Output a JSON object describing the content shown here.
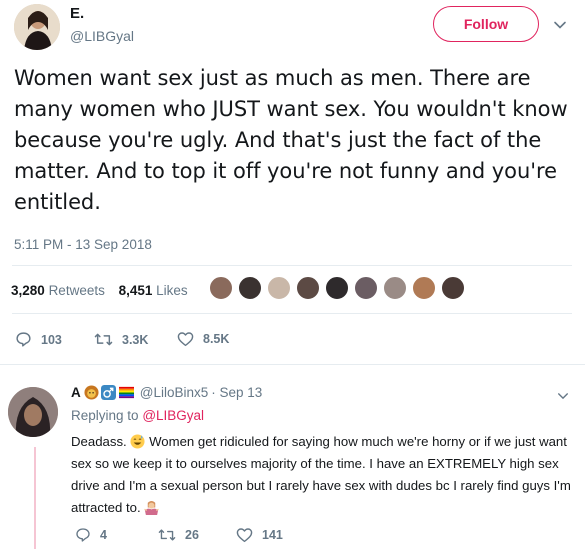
{
  "main_tweet": {
    "author_name": "E.",
    "author_handle": "@LIBGyal",
    "follow_label": "Follow",
    "text": "Women want sex just as much as men. There are many women who JUST want sex. You wouldn't know because you're ugly. And that's just the fact of the matter. And to top it off you're not funny and you're entitled.",
    "timestamp": "5:11 PM - 13 Sep 2018",
    "retweets_count": "3,280",
    "retweets_label": "Retweets",
    "likes_count": "8,451",
    "likes_label": "Likes",
    "actions": {
      "replies": "103",
      "retweets": "3.3K",
      "likes": "8.5K"
    }
  },
  "reply": {
    "author_name": "A",
    "author_handle": "@LiloBinx5",
    "date": "· Sep 13",
    "replying_to_prefix": "Replying to",
    "replying_to_handle": "@LIBGyal",
    "text_part1": "Deadass.",
    "text_part2": "Women get ridiculed for saying how much we're horny or if we just want sex so we keep it to ourselves majority of the time. I have an EXTREMELY high sex drive and I'm a sexual person but I rarely have sex with dudes bc I rarely find guys I'm attracted to.",
    "actions": {
      "replies": "4",
      "retweets": "26",
      "likes": "141"
    }
  },
  "colors": {
    "accent": "#e0245e",
    "muted": "#657786",
    "text": "#14171a",
    "divider": "#e6ecf0"
  },
  "icons": [
    "chevron-down-icon",
    "reply-icon",
    "retweet-icon",
    "like-icon",
    "grinning-sweat-emoji",
    "woman-shrugging-emoji",
    "lion-emoji",
    "male-sign-emoji",
    "rainbow-flag-emoji"
  ]
}
